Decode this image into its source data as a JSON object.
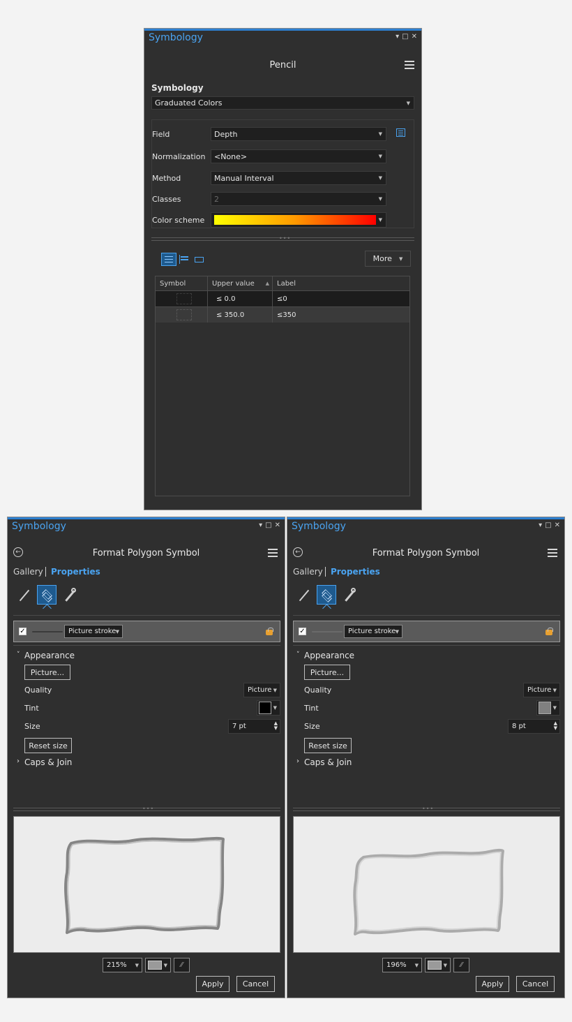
{
  "top_panel": {
    "title": "Symbology",
    "heading": "Pencil",
    "section_label": "Symbology",
    "renderer": "Graduated Colors",
    "fields": [
      {
        "label": "Field",
        "value": "Depth"
      },
      {
        "label": "Normalization",
        "value": "<None>"
      },
      {
        "label": "Method",
        "value": "Manual Interval"
      },
      {
        "label": "Classes",
        "value": "2"
      },
      {
        "label": "Color scheme",
        "value": ""
      }
    ],
    "more_label": "More",
    "table": {
      "headers": [
        "Symbol",
        "Upper value",
        "Label"
      ],
      "rows": [
        {
          "upper": "≤  0.0",
          "label": "≤0"
        },
        {
          "upper": "≤  350.0",
          "label": "≤350"
        }
      ]
    },
    "colors": {
      "scheme_start": "#ffff00",
      "scheme_end": "#ff0000",
      "accent": "#2d7fd0"
    }
  },
  "bottom_panels": [
    {
      "title": "Symbology",
      "heading": "Format Polygon Symbol",
      "tabs": [
        "Gallery",
        "Properties"
      ],
      "layer_name": "Picture stroke",
      "appearance_label": "Appearance",
      "picture_button": "Picture...",
      "quality_label": "Quality",
      "quality_value": "Picture",
      "tint_label": "Tint",
      "tint_color": "#000000",
      "size_label": "Size",
      "size_value": "7 pt",
      "reset_label": "Reset size",
      "caps_label": "Caps & Join",
      "zoom": "215%",
      "apply": "Apply",
      "cancel": "Cancel"
    },
    {
      "title": "Symbology",
      "heading": "Format Polygon Symbol",
      "tabs": [
        "Gallery",
        "Properties"
      ],
      "layer_name": "Picture stroke",
      "appearance_label": "Appearance",
      "picture_button": "Picture...",
      "quality_label": "Quality",
      "quality_value": "Picture",
      "tint_label": "Tint",
      "tint_color": "#808080",
      "size_label": "Size",
      "size_value": "8 pt",
      "reset_label": "Reset size",
      "caps_label": "Caps & Join",
      "zoom": "196%",
      "apply": "Apply",
      "cancel": "Cancel"
    }
  ]
}
